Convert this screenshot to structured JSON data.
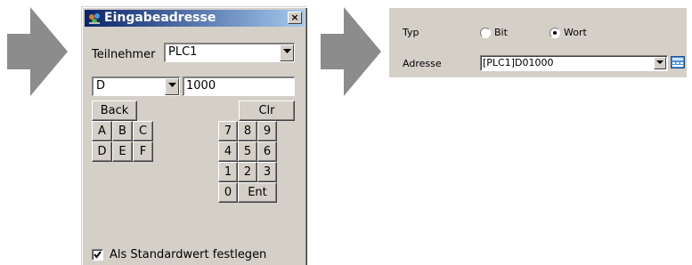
{
  "dialog": {
    "title": "Eingabeadresse",
    "close_label": "×",
    "participant_label": "Teilnehmer",
    "participant_value": "PLC1",
    "device_value": "D",
    "address_value": "1000",
    "keys": {
      "back": "Back",
      "clr": "Clr",
      "a": "A",
      "b": "B",
      "c": "C",
      "d": "D",
      "e": "E",
      "f": "F",
      "n7": "7",
      "n8": "8",
      "n9": "9",
      "n4": "4",
      "n5": "5",
      "n6": "6",
      "n1": "1",
      "n2": "2",
      "n3": "3",
      "n0": "0",
      "ent": "Ent"
    },
    "default_checkbox_label": "Als Standardwert festlegen",
    "default_checked": true
  },
  "panel": {
    "type_label": "Typ",
    "option_bit": "Bit",
    "option_wort": "Wort",
    "selected_option": "Wort",
    "address_label": "Adresse",
    "address_value": "[PLC1]D01000"
  },
  "colors": {
    "arrow": "#8c8c8c",
    "face": "#d4d0c8",
    "title_start": "#0a246a",
    "title_end": "#a6caf0"
  },
  "icons": [
    "arrow-right-icon",
    "app-icon",
    "close-icon",
    "dropdown-arrow-icon",
    "checkmark-icon",
    "keypad-icon"
  ]
}
